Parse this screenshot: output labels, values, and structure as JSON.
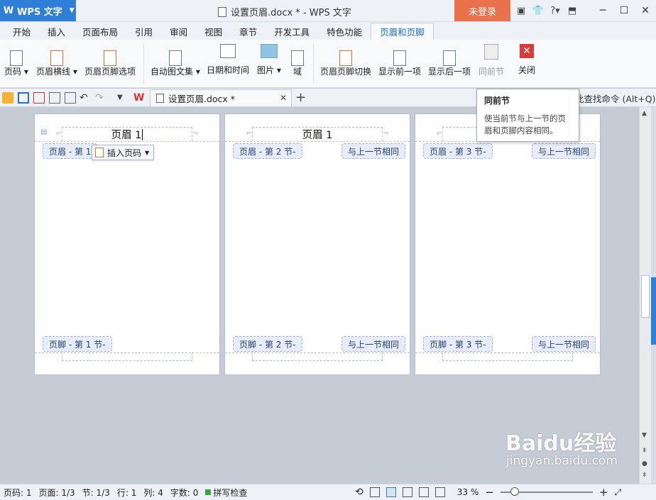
{
  "app": {
    "name": "WPS 文字",
    "window_title": "设置页眉.docx * - WPS 文字",
    "login_label": "未登录"
  },
  "menu_tabs": [
    "开始",
    "插入",
    "页面布局",
    "引用",
    "审阅",
    "视图",
    "章节",
    "开发工具",
    "特色功能",
    "页眉和页脚"
  ],
  "ribbon": {
    "page_number": "页码",
    "header_line": "页眉横线",
    "header_footer_options": "页眉页脚选项",
    "auto_text": "自动图文集",
    "date_time": "日期和时间",
    "picture": "图片",
    "field": "域",
    "switch": "页眉页脚切换",
    "show_prev": "显示前一项",
    "show_next": "显示后一项",
    "same_as_prev": "同前节",
    "close": "关闭"
  },
  "doc_tab": {
    "name": "设置页眉.docx *",
    "find_command": "此查找命令 (Alt+Q)"
  },
  "tooltip": {
    "title": "同前节",
    "body": "使当前节与上一节的页眉和页脚内容相同。"
  },
  "pages": [
    {
      "header_text": "页眉 1",
      "header_tag": "页眉  - 第 1",
      "footer_tag": "页脚  - 第 1 节-",
      "insert_page_number": "插入页码"
    },
    {
      "header_text": "页眉 1",
      "header_tag": "页眉  - 第 2 节-",
      "header_link": "与上一节相同",
      "footer_tag": "页脚  - 第 2 节-",
      "footer_link": "与上一节相同"
    },
    {
      "header_tag": "页眉  - 第 3 节-",
      "header_link": "与上一节相同",
      "footer_tag": "页脚  - 第 3 节-",
      "footer_link": "与上一节相同"
    }
  ],
  "status": {
    "page_no": "页码: 1",
    "pages": "页面: 1/3",
    "section": "节: 1/3",
    "line": "行: 1",
    "column": "列: 4",
    "word_count": "字数: 0",
    "spell_check": "拼写检查",
    "zoom": "33 %"
  },
  "watermark": {
    "brand": "Baidu经验",
    "url": "jingyan.baidu.com"
  }
}
